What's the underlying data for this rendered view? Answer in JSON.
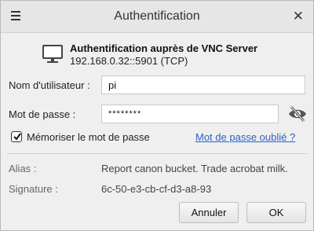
{
  "window": {
    "title": "Authentification"
  },
  "header": {
    "title": "Authentification auprès de VNC Server",
    "address": "192.168.0.32::5901 (TCP)"
  },
  "form": {
    "username_label": "Nom d'utilisateur :",
    "username_value": "pi",
    "password_label": "Mot de passe :",
    "password_value": "********",
    "remember_label": "Mémoriser le mot de passe",
    "remember_checked": true,
    "forgot_link": "Mot de passe oublié ?"
  },
  "info": {
    "alias_label": "Alias :",
    "alias_value": "Report canon bucket. Trade acrobat milk.",
    "signature_label": "Signature :",
    "signature_value": "6c-50-e3-cb-cf-d3-a8-93"
  },
  "buttons": {
    "cancel": "Annuler",
    "ok": "OK"
  },
  "icons": [
    "menu-icon",
    "close-icon",
    "monitor-icon",
    "eye-slash-icon",
    "checkmark-icon"
  ]
}
